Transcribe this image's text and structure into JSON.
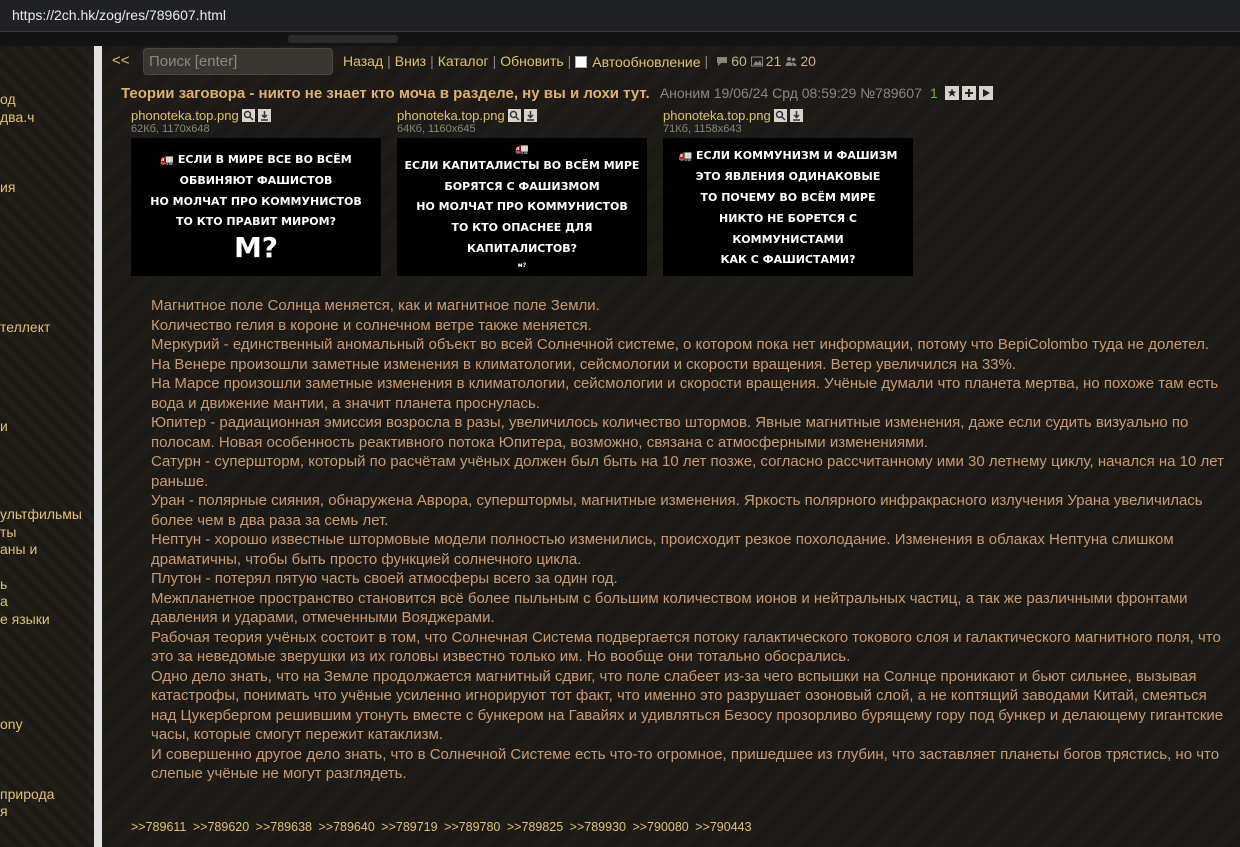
{
  "browser": {
    "url": "https://2ch.hk/zog/res/789607.html"
  },
  "sidebar": {
    "items": [
      "од",
      "два.ч",
      "ия",
      "теллект",
      "и",
      "ультфильмы",
      "ты",
      "аны и",
      "ь",
      "а",
      "е языки",
      "ony",
      "природа",
      "я"
    ]
  },
  "nav": {
    "back": "<<",
    "search_placeholder": "Поиск [enter]",
    "links": [
      "Назад",
      "Вниз",
      "Каталог",
      "Обновить"
    ],
    "autoupdate_label": "Автообновление",
    "stats": {
      "posts": "60",
      "images": "21",
      "posters": "20"
    }
  },
  "thread": {
    "subject": "Теории заговора - никто не знает кто моча в разделе, ну вы и лохи тут.",
    "meta": "Аноним 19/06/24 Срд 08:59:29 №789607",
    "reply_count": "1"
  },
  "images": [
    {
      "filename": "phonoteka.top.png",
      "info": "62Кб, 1170x648",
      "lines": [
        "🚛 ЕСЛИ В МИРЕ ВСЕ ВО ВСЁМ",
        "ОБВИНЯЮТ ФАШИСТОВ",
        "НО МОЛЧАТ ПРО КОММУНИСТОВ",
        "ТО КТО ПРАВИТ МИРОМ?"
      ],
      "big": "М?",
      "tiny": ""
    },
    {
      "filename": "phonoteka.top.png",
      "info": "64Кб, 1160x645",
      "lines": [
        "🚛",
        "ЕСЛИ КАПИТАЛИСТЫ ВО ВСЁМ МИРЕ",
        "БОРЯТСЯ С ФАШИЗМОМ",
        "НО МОЛЧАТ ПРО КОММУНИСТОВ",
        "ТО КТО ОПАСНЕЕ ДЛЯ КАПИТАЛИСТОВ?"
      ],
      "big": "",
      "tiny": "м?"
    },
    {
      "filename": "phonoteka.top.png",
      "info": "71Кб, 1158x643",
      "lines": [
        "🚛 ЕСЛИ КОММУНИЗМ И ФАШИЗМ",
        "ЭТО ЯВЛЕНИЯ ОДИНАКОВЫЕ",
        "ТО ПОЧЕМУ ВО ВСЁМ МИРЕ",
        "НИКТО НЕ БОРЕТСЯ С КОММУНИСТАМИ",
        "КАК С ФАШИСТАМИ?"
      ],
      "big": "",
      "tiny": ""
    }
  ],
  "post": {
    "lines": [
      "Магнитное поле Солнца меняется, как и магнитное поле Земли.",
      "Количество гелия в короне и солнечном ветре также меняется.",
      "Меркурий - единственный аномальный объект во всей Солнечной системе, о котором пока нет информации, потому что BepiColombo туда не долетел.",
      "На Венере произошли заметные изменения в климатологии, сейсмологии и скорости вращения. Ветер увеличился на 33%.",
      "На Марсе произошли заметные изменения в климатологии, сейсмологии и скорости вращения. Учёные думали что планета мертва, но похоже там есть вода и движение мантии, а значит планета проснулась.",
      "Юпитер - радиационная эмиссия возросла в разы, увеличилось количество штормов. Явные магнитные изменения, даже если судить визуально по полосам. Новая особенность реактивного потока Юпитера, возможно, связана с атмосферными изменениями.",
      "Сатурн - супершторм, который по расчётам учёных должен был быть на 10 лет позже, согласно рассчитанному ими 30 летнему циклу, начался на 10 лет раньше.",
      "Уран - полярные сияния, обнаружена Аврора, суперштормы, магнитные изменения. Яркость полярного инфракрасного излучения Урана увеличилась более чем в два раза за семь лет.",
      "Нептун - хорошо известные штормовые модели полностью изменились, происходит резкое похолодание. Изменения в облаках Нептуна слишком драматичны, чтобы быть просто функцией солнечного цикла.",
      "Плутон - потерял пятую часть своей атмосферы всего за один год.",
      "Межпланетное пространство становится всё более пыльным с большим количеством ионов и нейтральных частиц, а так же различными фронтами давления и ударами, отмеченными Вояджерами.",
      "Рабочая теория учёных состоит в том, что Солнечная Система подвергается потоку галактического токового слоя и галактического магнитного поля, что это за неведомые зверушки из их головы известно только им. Но вообще они тотально обосрались.",
      "Одно дело знать, что на Земле продолжается магнитный сдвиг, что поле слабеет из-за чего вспышки на Солнце проникают и бьют сильнее, вызывая катастрофы, понимать что учёные усиленно игнорируют тот факт, что именно это разрушает озоновый слой, а не коптящий заводами Китай, смеяться над Цукербергом решившим утонуть вместе с бункером на Гавайях и удивляться Безосу прозорливо бурящему гору под бункер и делающему гигантские часы, которые смогут пережит катаклизм.",
      "И совершенно другое дело знать, что в Солнечной Системе есть что-то огромное, пришедшее из глубин, что заставляет планеты богов трястись, но что слепые учёные не могут разглядеть."
    ],
    "replies": [
      ">>789611",
      ">>789620",
      ">>789638",
      ">>789640",
      ">>789719",
      ">>789780",
      ">>789825",
      ">>789930",
      ">>790080",
      ">>790443"
    ]
  }
}
